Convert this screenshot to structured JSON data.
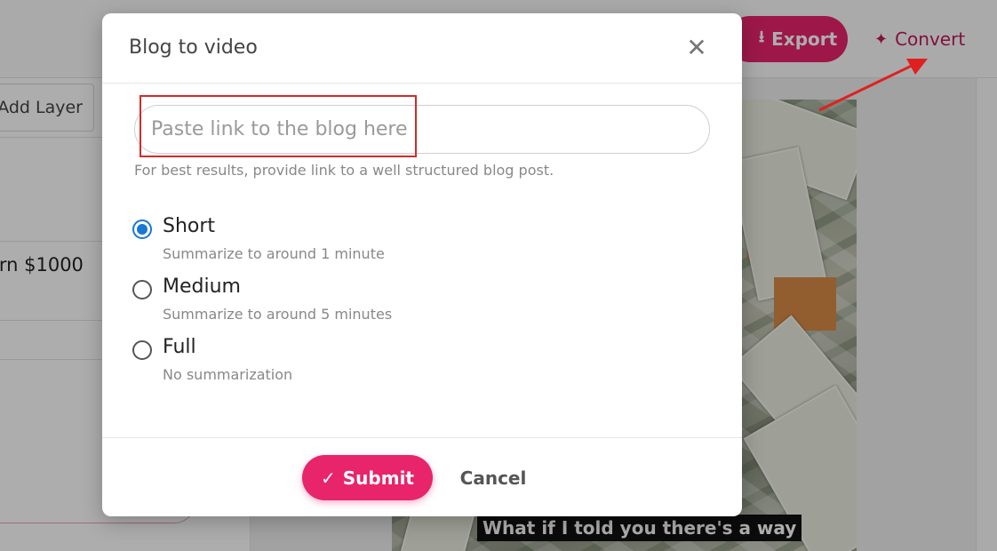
{
  "toolbar": {
    "export_label": "Export",
    "export_icon": "download-icon",
    "convert_label": "Convert",
    "convert_icon": "sparkle-icon"
  },
  "left_panel": {
    "add_layer_label": "Add Layer",
    "layer_text": "arn $1000"
  },
  "preview": {
    "caption": "What if I told you there's a way"
  },
  "modal": {
    "title": "Blog to video",
    "close_icon": "close-icon",
    "url_placeholder": "Paste link to the blog here",
    "url_value": "",
    "help_text": "For best results, provide link to a well structured blog post.",
    "options": [
      {
        "label": "Short",
        "description": "Summarize to around 1 minute",
        "selected": true
      },
      {
        "label": "Medium",
        "description": "Summarize to around 5 minutes",
        "selected": false
      },
      {
        "label": "Full",
        "description": "No summarization",
        "selected": false
      }
    ],
    "submit_label": "Submit",
    "submit_icon": "check-icon",
    "cancel_label": "Cancel"
  },
  "colors": {
    "accent": "#e8246a",
    "convert_text": "#c2185b",
    "radio_selected": "#1976d2",
    "annotation_red": "#d12b2b"
  }
}
